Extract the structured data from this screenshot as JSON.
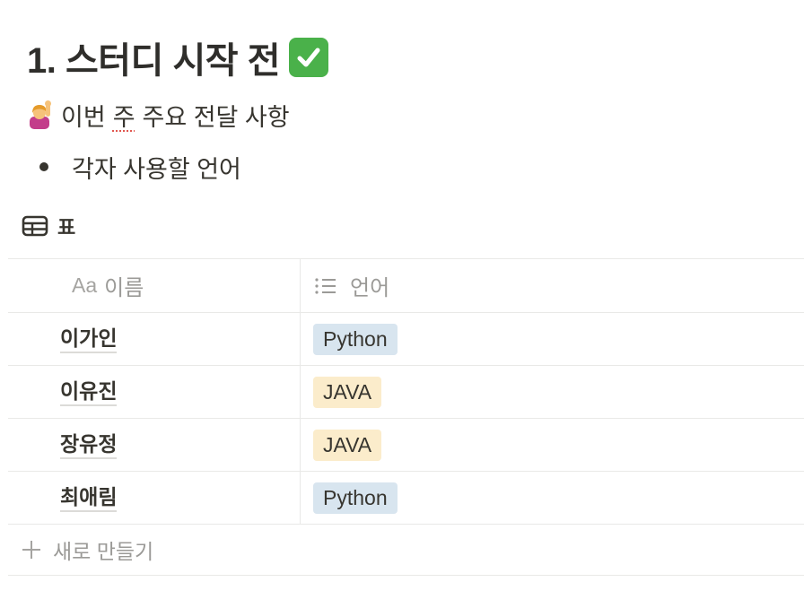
{
  "page": {
    "heading": "1. 스터디 시작 전",
    "heading_icon": "check-mark-button-icon",
    "callout": {
      "icon": "person-raising-hand-icon",
      "before": "이번",
      "spell": "주",
      "after": "주요 전달 사항"
    },
    "bullet": "각자 사용할 언어"
  },
  "database": {
    "icon": "table-icon",
    "title": "표",
    "columns": [
      {
        "icon": "Aa",
        "label": "이름"
      },
      {
        "icon": "list-icon",
        "label": "언어"
      }
    ],
    "rows": [
      {
        "name": "이가인",
        "language": "Python"
      },
      {
        "name": "이유진",
        "language": "JAVA"
      },
      {
        "name": "장유정",
        "language": "JAVA"
      },
      {
        "name": "최애림",
        "language": "Python"
      }
    ],
    "new_label": "새로 만들기"
  },
  "colors": {
    "tag_python": "#d8e5ef",
    "tag_java": "#fbeccb",
    "check": "#4ab14a",
    "spellcheck": "#e0574f"
  }
}
